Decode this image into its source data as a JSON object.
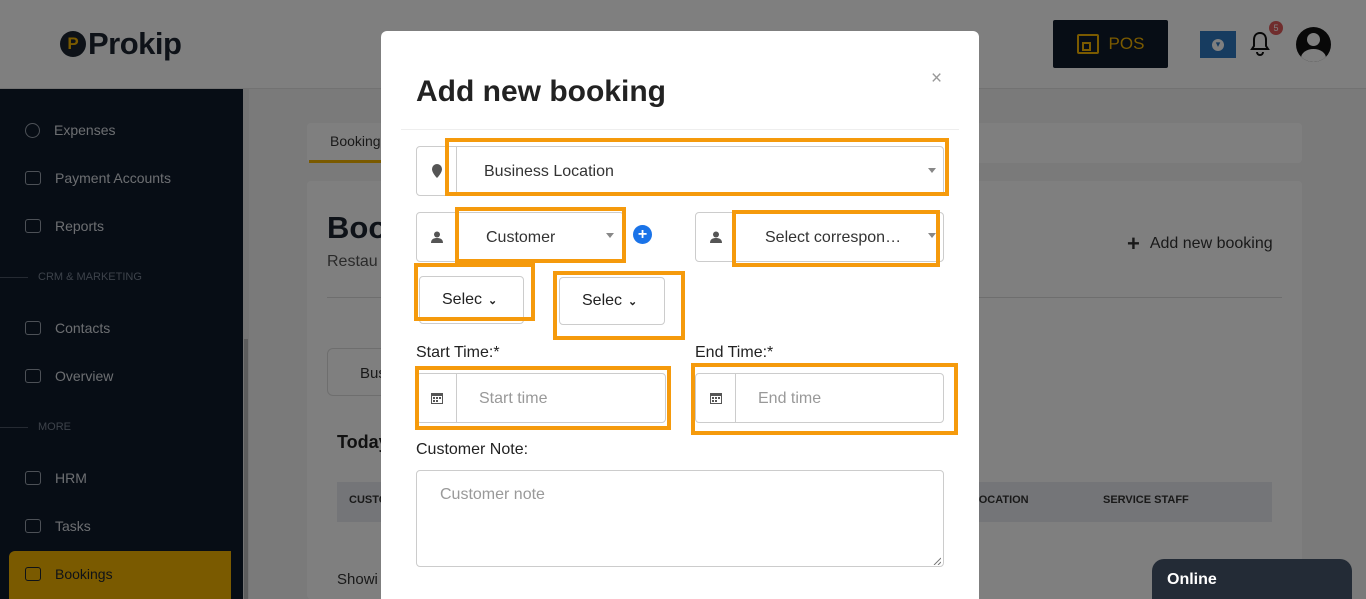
{
  "brand": {
    "logo_mark": "P",
    "logo_text": "Prokip"
  },
  "header": {
    "pos_label": "POS",
    "notification_count": "5"
  },
  "sidebar": {
    "items": [
      {
        "label": "Expenses"
      },
      {
        "label": "Payment Accounts"
      },
      {
        "label": "Reports"
      },
      {
        "label": "Contacts"
      },
      {
        "label": "Overview"
      },
      {
        "label": "HRM"
      },
      {
        "label": "Tasks"
      },
      {
        "label": "Bookings"
      }
    ],
    "sections": [
      "CRM & MARKETING",
      "MORE"
    ]
  },
  "page": {
    "tab": "Bookings",
    "title": "Boo",
    "subtitle": "Restau",
    "add_label": "Add new booking",
    "filter_button": "Bus",
    "today_heading": "Today",
    "table_headers": [
      "CUSTO",
      "LOCATION",
      "SERVICE STAFF"
    ],
    "showing_text": "Showi"
  },
  "modal": {
    "title": "Add new booking",
    "close": "×",
    "business_location": "Business Location",
    "customer": "Customer",
    "correspondent": "Select correspon…",
    "select_1": "Selec",
    "select_2": "Selec",
    "start_time_label": "Start Time:*",
    "start_time_placeholder": "Start time",
    "end_time_label": "End Time:*",
    "end_time_placeholder": "End time",
    "customer_note_label": "Customer Note:",
    "customer_note_placeholder": "Customer note"
  },
  "chat": {
    "status": "Online"
  },
  "colors": {
    "accent": "#f5b400",
    "highlight": "#f59a0c",
    "sidebar": "#0e1a2b"
  }
}
